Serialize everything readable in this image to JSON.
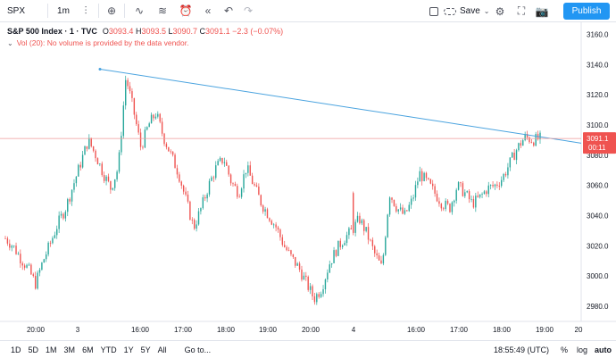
{
  "toolbar": {
    "symbol": "SPX",
    "interval": "1m",
    "save_label": "Save",
    "publish_label": "Publish"
  },
  "legend": {
    "title": "S&P 500 Index · 1 · TVC",
    "o_label": "O",
    "o": "3093.4",
    "h_label": "H",
    "h": "3093.5",
    "l_label": "L",
    "l": "3090.7",
    "c_label": "C",
    "c": "3091.1",
    "change": "−2.3 (−0.07%)",
    "vol_text": "Vol (20): No volume is provided by the data vendor."
  },
  "price_axis": {
    "ticks": [
      "3160.0",
      "3140.0",
      "3120.0",
      "3100.0",
      "3080.0",
      "3060.0",
      "3040.0",
      "3020.0",
      "3000.0",
      "2980.0"
    ],
    "last_price": "3091.1",
    "countdown": "00:11"
  },
  "time_axis": {
    "ticks": [
      "20:00",
      "3",
      "16:00",
      "17:00",
      "18:00",
      "19:00",
      "20:00",
      "4",
      "16:00",
      "17:00",
      "18:00",
      "19:00",
      "20"
    ]
  },
  "bottom": {
    "ranges": [
      "1D",
      "5D",
      "1M",
      "3M",
      "6M",
      "YTD",
      "1Y",
      "5Y",
      "All"
    ],
    "goto": "Go to...",
    "clock": "18:55:49 (UTC)",
    "percent": "%",
    "log": "log",
    "auto": "auto"
  },
  "chart_data": {
    "type": "candlestick",
    "ylim": [
      2970,
      3168
    ],
    "up_color": "#26a69a",
    "down_color": "#ef5350",
    "trendline_color": "#4aa3df",
    "price_line_color": "#ef9a9a",
    "trendline": {
      "from": 3137,
      "to": 3088
    },
    "close_path": [
      3025,
      3020,
      3012,
      3005,
      2995,
      3010,
      3022,
      3035,
      3045,
      3060,
      3075,
      3090,
      3080,
      3068,
      3058,
      3072,
      3132,
      3110,
      3085,
      3100,
      3108,
      3092,
      3080,
      3068,
      3050,
      3032,
      3045,
      3060,
      3072,
      3078,
      3062,
      3055,
      3072,
      3060,
      3048,
      3040,
      3032,
      3020,
      3012,
      3005,
      2995,
      2985,
      2992,
      3008,
      3018,
      3025,
      3030,
      3038,
      3028,
      3015,
      3005,
      3055,
      3045,
      3040,
      3050,
      3068,
      3062,
      3055,
      3048,
      3045,
      3060,
      3055,
      3048,
      3052,
      3058,
      3060,
      3065,
      3075,
      3085,
      3092,
      3090,
      3091
    ]
  }
}
